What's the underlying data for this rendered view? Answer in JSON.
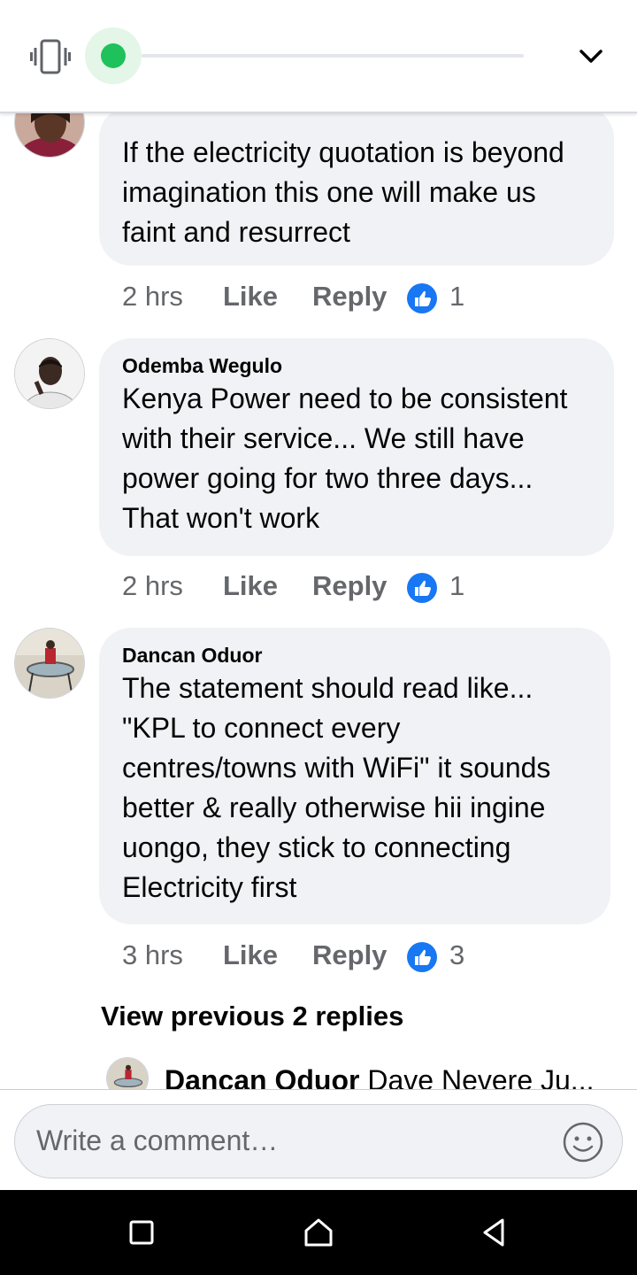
{
  "top_bar": {
    "icons": [
      "vibrate-icon",
      "recording-dot",
      "chevron-down-icon"
    ],
    "accent_color": "#1ec15b"
  },
  "comments": [
    {
      "author": "",
      "text_lines": [
        "If the electricity quotation is beyond",
        "imagination this one will make us",
        "faint and resurrect"
      ],
      "time": "2 hrs",
      "like_label": "Like",
      "reply_label": "Reply",
      "reactions": "1"
    },
    {
      "author": "Odemba Wegulo",
      "text_lines": [
        "Kenya Power need to be consistent",
        "with their service... We still have",
        "power going for two three days...",
        "That won't work"
      ],
      "time": "2 hrs",
      "like_label": "Like",
      "reply_label": "Reply",
      "reactions": "1"
    },
    {
      "author": "Dancan Oduor",
      "text_lines": [
        "The statement should read like...",
        "\"KPL to connect every",
        "centres/towns with WiFi\" it sounds",
        "better & really otherwise hii ingine",
        "uongo, they stick to connecting",
        "Electricity first"
      ],
      "time": "3 hrs",
      "like_label": "Like",
      "reply_label": "Reply",
      "reactions": "3"
    }
  ],
  "view_previous": "View previous 2 replies",
  "reply_preview": {
    "author": "Dancan Oduor",
    "text": "Dave Nevere Ju..."
  },
  "composer": {
    "placeholder": "Write a comment…"
  },
  "colors": {
    "bubble": "#f0f2f5",
    "like_blue": "#1877f2",
    "meta_gray": "#65676b"
  }
}
